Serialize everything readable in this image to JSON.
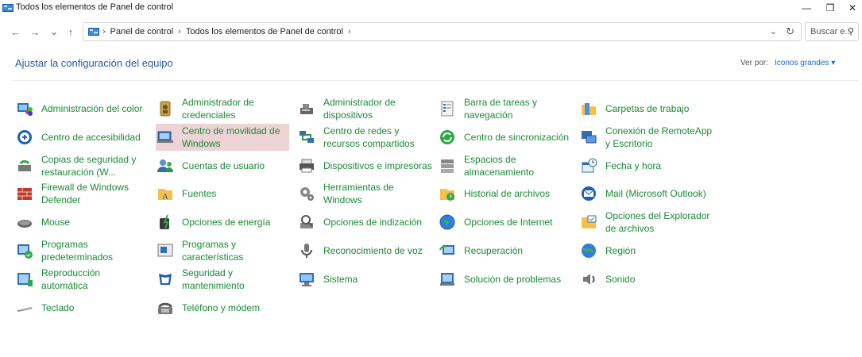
{
  "window": {
    "title": "Todos los elementos de Panel de control",
    "minimize": "—",
    "maximize": "❐",
    "close": "✕"
  },
  "nav": {
    "back": "←",
    "forward": "→",
    "recent": "⌄",
    "up": "↑"
  },
  "address": {
    "crumbs": [
      "Panel de control",
      "Todos los elementos de Panel de control"
    ],
    "sep": "›",
    "dropdown": "⌄",
    "refresh": "↻"
  },
  "search": {
    "placeholder": "Buscar e...",
    "icon": "⚲"
  },
  "heading": "Ajustar la configuración del equipo",
  "viewby": {
    "label": "Ver por:",
    "value": "Iconos grandes ▾"
  },
  "items": [
    {
      "label": "Administración del color",
      "icon": "color-management-icon"
    },
    {
      "label": "Administrador de credenciales",
      "icon": "credential-manager-icon"
    },
    {
      "label": "Administrador de dispositivos",
      "icon": "device-manager-icon"
    },
    {
      "label": "Barra de tareas y navegación",
      "icon": "taskbar-icon"
    },
    {
      "label": "Carpetas de trabajo",
      "icon": "work-folders-icon"
    },
    {
      "label": "Centro de accesibilidad",
      "icon": "accessibility-icon"
    },
    {
      "label": "Centro de movilidad de Windows",
      "icon": "mobility-center-icon"
    },
    {
      "label": "Centro de redes y recursos compartidos",
      "icon": "network-center-icon"
    },
    {
      "label": "Centro de sincronización",
      "icon": "sync-center-icon"
    },
    {
      "label": "Conexión de RemoteApp y Escritorio",
      "icon": "remoteapp-icon"
    },
    {
      "label": "Copias de seguridad y restauración (W...",
      "icon": "backup-icon"
    },
    {
      "label": "Cuentas de usuario",
      "icon": "user-accounts-icon"
    },
    {
      "label": "Dispositivos e impresoras",
      "icon": "devices-printers-icon"
    },
    {
      "label": "Espacios de almacenamiento",
      "icon": "storage-spaces-icon"
    },
    {
      "label": "Fecha y hora",
      "icon": "date-time-icon"
    },
    {
      "label": "Firewall de Windows Defender",
      "icon": "firewall-icon"
    },
    {
      "label": "Fuentes",
      "icon": "fonts-icon"
    },
    {
      "label": "Herramientas de Windows",
      "icon": "windows-tools-icon"
    },
    {
      "label": "Historial de archivos",
      "icon": "file-history-icon"
    },
    {
      "label": "Mail (Microsoft Outlook)",
      "icon": "mail-icon"
    },
    {
      "label": "Mouse",
      "icon": "mouse-icon"
    },
    {
      "label": "Opciones de energía",
      "icon": "power-options-icon"
    },
    {
      "label": "Opciones de indización",
      "icon": "indexing-icon"
    },
    {
      "label": "Opciones de Internet",
      "icon": "internet-options-icon"
    },
    {
      "label": "Opciones del Explorador de archivos",
      "icon": "explorer-options-icon"
    },
    {
      "label": "Programas predeterminados",
      "icon": "default-programs-icon"
    },
    {
      "label": "Programas y características",
      "icon": "programs-features-icon"
    },
    {
      "label": "Reconocimiento de voz",
      "icon": "speech-recognition-icon"
    },
    {
      "label": "Recuperación",
      "icon": "recovery-icon"
    },
    {
      "label": "Región",
      "icon": "region-icon"
    },
    {
      "label": "Reproducción automática",
      "icon": "autoplay-icon"
    },
    {
      "label": "Seguridad y mantenimiento",
      "icon": "security-maintenance-icon"
    },
    {
      "label": "Sistema",
      "icon": "system-icon"
    },
    {
      "label": "Solución de problemas",
      "icon": "troubleshooting-icon"
    },
    {
      "label": "Sonido",
      "icon": "sound-icon"
    },
    {
      "label": "Teclado",
      "icon": "keyboard-icon"
    },
    {
      "label": "Teléfono y módem",
      "icon": "phone-modem-icon"
    }
  ]
}
